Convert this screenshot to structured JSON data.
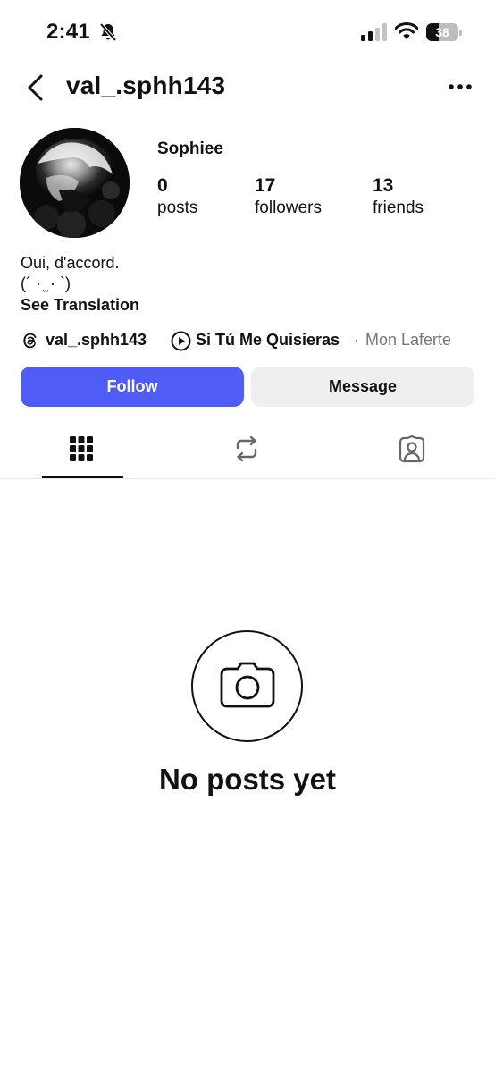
{
  "status_bar": {
    "time": "2:41",
    "battery": "38",
    "battery_level": 0.38,
    "icons": [
      "bell-slash-icon",
      "cellular-signal-icon",
      "wifi-icon",
      "battery-icon"
    ]
  },
  "header": {
    "username": "val_.sphh143",
    "back_icon": "chevron-left-icon",
    "more_icon": "more-horizontal-icon"
  },
  "profile": {
    "display_name": "Sophiee",
    "stats": [
      {
        "value": "0",
        "label": "posts"
      },
      {
        "value": "17",
        "label": "followers"
      },
      {
        "value": "13",
        "label": "friends"
      }
    ],
    "bio_line1": "Oui, d'accord.",
    "bio_line2": "(´ · ̫ · `)",
    "see_translation": "See Translation",
    "threads_handle": "val_.sphh143",
    "song_title": "Si Tú Me Quisieras",
    "song_separator": "·",
    "song_artist": "Mon Laferte"
  },
  "actions": {
    "follow": "Follow",
    "message": "Message",
    "follow_color": "#4e5bf5"
  },
  "tabs": [
    {
      "icon": "grid-icon",
      "active": true
    },
    {
      "icon": "repost-icon",
      "active": false
    },
    {
      "icon": "tagged-person-icon",
      "active": false
    }
  ],
  "empty_state": {
    "icon": "camera-icon",
    "text": "No posts yet"
  }
}
